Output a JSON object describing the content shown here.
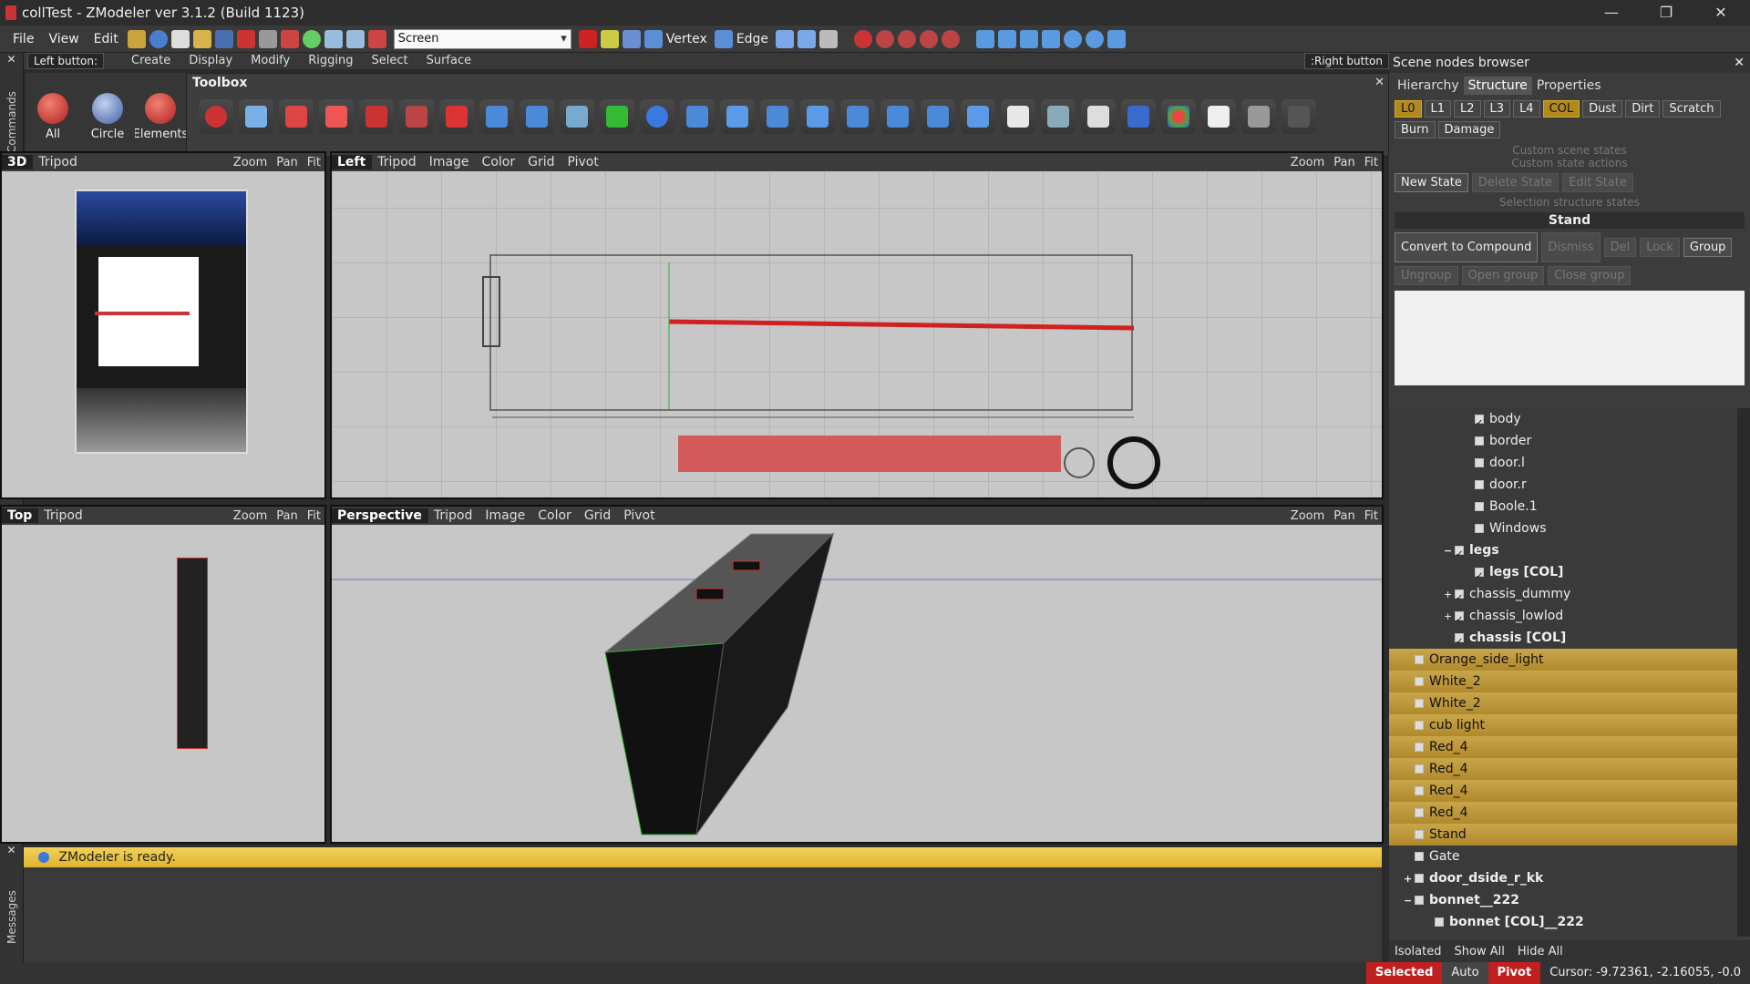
{
  "window": {
    "title": "collTest - ZModeler ver 3.1.2 (Build 1123)",
    "minimize": "—",
    "maximize": "❐",
    "close": "✕"
  },
  "menu": {
    "items": [
      "File",
      "View",
      "Edit"
    ],
    "screen_select": "Screen",
    "vertex_label": "Vertex",
    "edge_label": "Edge"
  },
  "left_button_bar": {
    "left_tag": "Left button:",
    "tabs": [
      "Create",
      "Display",
      "Modify",
      "Rigging",
      "Select",
      "Surface"
    ],
    "right_tag": ":Right button"
  },
  "side_labels": {
    "commands": "Commands",
    "messages": "Messages"
  },
  "modes": [
    {
      "label": "All",
      "color": "#d23a2a"
    },
    {
      "label": "Circle",
      "color": "#6a8ac8"
    },
    {
      "label": "Elements",
      "color": "#d23a2a"
    }
  ],
  "toolbox": {
    "title": "Toolbox",
    "close": "✕"
  },
  "viewports": {
    "v3d": {
      "name": "3D",
      "tripod": "Tripod"
    },
    "left": {
      "name": "Left",
      "items": [
        "Tripod",
        "Image",
        "Color",
        "Grid",
        "Pivot"
      ]
    },
    "top": {
      "name": "Top",
      "tripod": "Tripod"
    },
    "perspective": {
      "name": "Perspective",
      "items": [
        "Tripod",
        "Image",
        "Color",
        "Grid",
        "Pivot"
      ]
    },
    "controls": [
      "Zoom",
      "Pan",
      "Fit"
    ]
  },
  "scene_browser": {
    "title": "Scene nodes browser",
    "tabs": [
      "Hierarchy",
      "Structure",
      "Properties"
    ],
    "levels": [
      "L0",
      "L1",
      "L2",
      "L3",
      "L4",
      "COL",
      "Dust",
      "Dirt",
      "Scratch"
    ],
    "levels2": [
      "Burn",
      "Damage"
    ],
    "custom_scene_states": "Custom scene states",
    "custom_state_actions": "Custom state actions",
    "new_state": "New State",
    "delete_state": "Delete State",
    "edit_state": "Edit State",
    "selection_structure_states": "Selection structure states",
    "stand": "Stand",
    "convert": "Convert to Compound",
    "dismiss": "Dismiss",
    "del": "Del",
    "lock": "Lock",
    "group": "Group",
    "ungroup": "Ungroup",
    "open_group": "Open group",
    "close_group": "Close group",
    "tree": [
      {
        "label": "body",
        "indent": 3,
        "checked": true,
        "hl": false,
        "bold": false,
        "exp": ""
      },
      {
        "label": "border",
        "indent": 3,
        "checked": false,
        "hl": false,
        "bold": false,
        "exp": ""
      },
      {
        "label": "door.l",
        "indent": 3,
        "checked": false,
        "hl": false,
        "bold": false,
        "exp": ""
      },
      {
        "label": "door.r",
        "indent": 3,
        "checked": false,
        "hl": false,
        "bold": false,
        "exp": ""
      },
      {
        "label": "Boole.1",
        "indent": 3,
        "checked": false,
        "hl": false,
        "bold": false,
        "exp": ""
      },
      {
        "label": "Windows",
        "indent": 3,
        "checked": false,
        "hl": false,
        "bold": false,
        "exp": ""
      },
      {
        "label": "legs",
        "indent": 2,
        "checked": true,
        "hl": false,
        "bold": true,
        "exp": "−"
      },
      {
        "label": "legs [COL]",
        "indent": 3,
        "checked": true,
        "hl": false,
        "bold": true,
        "exp": ""
      },
      {
        "label": "chassis_dummy",
        "indent": 2,
        "checked": true,
        "hl": false,
        "bold": false,
        "exp": "+"
      },
      {
        "label": "chassis_lowlod",
        "indent": 2,
        "checked": true,
        "hl": false,
        "bold": false,
        "exp": "+"
      },
      {
        "label": "chassis [COL]",
        "indent": 2,
        "checked": true,
        "hl": false,
        "bold": true,
        "exp": ""
      },
      {
        "label": "Orange_side_light",
        "indent": 0,
        "checked": false,
        "hl": true,
        "bold": false,
        "exp": ""
      },
      {
        "label": "White_2",
        "indent": 0,
        "checked": false,
        "hl": true,
        "bold": false,
        "exp": ""
      },
      {
        "label": "White_2",
        "indent": 0,
        "checked": false,
        "hl": true,
        "bold": false,
        "exp": ""
      },
      {
        "label": "cub light",
        "indent": 0,
        "checked": false,
        "hl": true,
        "bold": false,
        "exp": ""
      },
      {
        "label": "Red_4",
        "indent": 0,
        "checked": false,
        "hl": true,
        "bold": false,
        "exp": ""
      },
      {
        "label": "Red_4",
        "indent": 0,
        "checked": false,
        "hl": true,
        "bold": false,
        "exp": ""
      },
      {
        "label": "Red_4",
        "indent": 0,
        "checked": false,
        "hl": true,
        "bold": false,
        "exp": ""
      },
      {
        "label": "Red_4",
        "indent": 0,
        "checked": false,
        "hl": true,
        "bold": false,
        "exp": ""
      },
      {
        "label": "Stand",
        "indent": 0,
        "checked": false,
        "hl": true,
        "bold": false,
        "exp": ""
      },
      {
        "label": "Gate",
        "indent": 0,
        "checked": false,
        "hl": false,
        "bold": false,
        "exp": ""
      },
      {
        "label": "door_dside_r_kk",
        "indent": 0,
        "checked": false,
        "hl": false,
        "bold": true,
        "exp": "+"
      },
      {
        "label": "bonnet__222",
        "indent": 0,
        "checked": false,
        "hl": false,
        "bold": true,
        "exp": "−"
      },
      {
        "label": "bonnet [COL]__222",
        "indent": 1,
        "checked": false,
        "hl": false,
        "bold": true,
        "exp": ""
      }
    ],
    "footer": [
      "Isolated",
      "Show All",
      "Hide All"
    ]
  },
  "messages": {
    "ready": "ZModeler is ready."
  },
  "statusbar": {
    "selected": "Selected",
    "auto": "Auto",
    "pivot": "Pivot",
    "cursor": "Cursor: -9.72361, -2.16055, -0.0"
  },
  "colors": {
    "accent_yellow": "#e0b42e",
    "selection_red": "#c02020"
  }
}
